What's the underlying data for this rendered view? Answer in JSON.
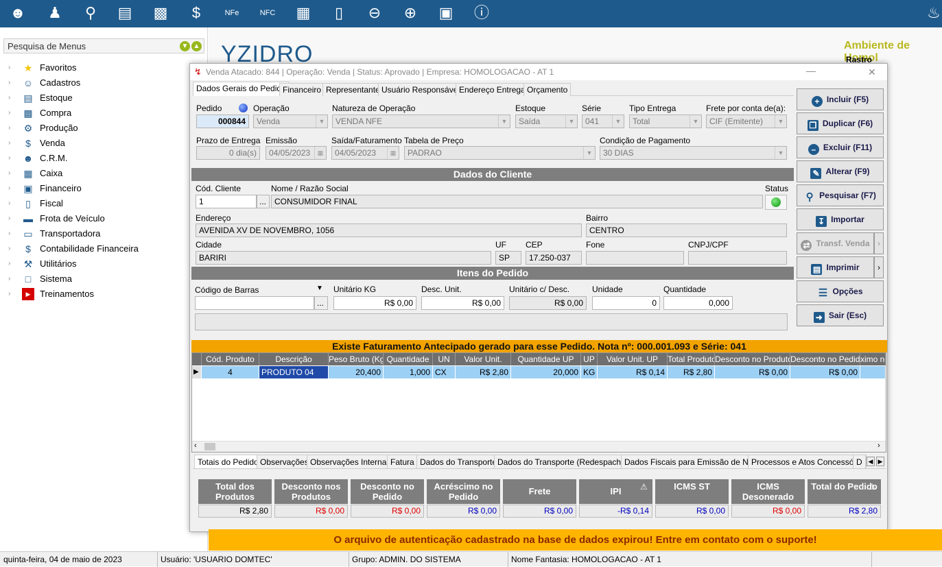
{
  "colors": {
    "topbar": "#1f5a8c",
    "banner": "#ffb400",
    "header": "#7e7e7e",
    "grid_selected": "#9dd0f5",
    "warning_bar": "#f2a300"
  },
  "topbar_icons": [
    "users-icon",
    "user-doc-icon",
    "search-doc-icon",
    "archive-icon",
    "basket-icon",
    "money-bag-icon",
    "nfe-icon",
    "nfce-icon",
    "cash-register-icon",
    "book-icon",
    "money-minus-icon",
    "money-plus-icon",
    "bill-icon",
    "info-icon",
    "bell-icon"
  ],
  "sidebar": {
    "search_placeholder": "Pesquisa de Menus",
    "items": [
      {
        "label": "Favoritos",
        "icon": "star-icon"
      },
      {
        "label": "Cadastros",
        "icon": "user-icon"
      },
      {
        "label": "Estoque",
        "icon": "box-icon"
      },
      {
        "label": "Compra",
        "icon": "basket-icon"
      },
      {
        "label": "Produção",
        "icon": "gear-icon"
      },
      {
        "label": "Venda",
        "icon": "money-bag-icon"
      },
      {
        "label": "C.R.M.",
        "icon": "people-icon"
      },
      {
        "label": "Caixa",
        "icon": "cash-register-icon"
      },
      {
        "label": "Financeiro",
        "icon": "money-icon"
      },
      {
        "label": "Fiscal",
        "icon": "document-icon"
      },
      {
        "label": "Frota de Veículo",
        "icon": "car-icon"
      },
      {
        "label": "Transportadora",
        "icon": "truck-icon"
      },
      {
        "label": "Contabilidade Financeira",
        "icon": "dollar-icon"
      },
      {
        "label": "Utilitários",
        "icon": "tools-icon"
      },
      {
        "label": "Sistema",
        "icon": "monitor-icon"
      },
      {
        "label": "Treinamentos",
        "icon": "youtube-icon"
      }
    ]
  },
  "background": {
    "logo": "YZIDRO",
    "ambiente": "Ambiente de Homol",
    "rastro": "Rastro"
  },
  "window": {
    "title": "Venda Atacado: 844 | Operação: Venda | Status: Aprovado | Empresa: HOMOLOGACAO - AT 1",
    "tabs": [
      "Dados Gerais do Pedido",
      "Financeiro",
      "Representante",
      "Usuário Responsável",
      "Endereço Entrega",
      "Orçamento"
    ],
    "labels": {
      "pedido": "Pedido",
      "operacao": "Operação",
      "natureza": "Natureza de Operação",
      "estoque": "Estoque",
      "serie": "Série",
      "tipo_entrega": "Tipo Entrega",
      "frete": "Frete por conta de(a):",
      "prazo": "Prazo de Entrega",
      "emissao": "Emissão",
      "saida": "Saída/Faturamento",
      "tabela": "Tabela de Preço",
      "condicao": "Condição de Pagamento",
      "cod_cliente": "Cód. Cliente",
      "nome": "Nome / Razão Social",
      "status": "Status",
      "endereco": "Endereço",
      "bairro": "Bairro",
      "cidade": "Cidade",
      "uf": "UF",
      "cep": "CEP",
      "fone": "Fone",
      "cnpj": "CNPJ/CPF",
      "codigo_barras": "Código de Barras",
      "unitario_kg": "Unitário KG",
      "desc_unit": "Desc. Unit.",
      "unitario_desc": "Unitário c/ Desc.",
      "unidade": "Unidade",
      "quantidade": "Quantidade"
    },
    "values": {
      "pedido": "000844",
      "operacao": "Venda",
      "natureza": "VENDA NFE",
      "estoque": "Saída",
      "serie": "041",
      "tipo_entrega": "Total",
      "frete": "CIF (Emitente)",
      "prazo": "0 dia(s)",
      "emissao": "04/05/2023",
      "saida": "04/05/2023",
      "tabela": "PADRAO",
      "condicao": "30 DIAS",
      "cod_cliente": "1",
      "nome": "CONSUMIDOR FINAL",
      "endereco": "AVENIDA XV DE NOVEMBRO, 1056",
      "bairro": "CENTRO",
      "cidade": "BARIRI",
      "uf": "SP",
      "cep": "17.250-037",
      "fone": "",
      "cnpj": "",
      "codigo_barras": "",
      "unitario_kg": "R$ 0,00",
      "desc_unit": "R$ 0,00",
      "unitario_desc": "R$ 0,00",
      "unidade": "0",
      "quantidade": "0,000"
    },
    "sections": {
      "cliente": "Dados do Cliente",
      "itens": "Itens do Pedido"
    },
    "ellipsis": "...",
    "buttons": [
      {
        "label": "Incluir (F5)",
        "icon": "plus-icon"
      },
      {
        "label": "Duplicar (F6)",
        "icon": "duplicate-icon"
      },
      {
        "label": "Excluir (F11)",
        "icon": "minus-icon"
      },
      {
        "label": "Alterar (F9)",
        "icon": "edit-icon"
      },
      {
        "label": "Pesquisar (F7)",
        "icon": "search-icon"
      },
      {
        "label": "Importar",
        "icon": "import-icon"
      },
      {
        "label": "Transf. Venda",
        "icon": "transfer-icon"
      },
      {
        "label": "Imprimir",
        "icon": "print-icon"
      },
      {
        "label": "Opções",
        "icon": "menu-icon"
      },
      {
        "label": "Sair (Esc)",
        "icon": "exit-icon"
      }
    ],
    "warning": "Existe Faturamento Antecipado gerado para esse Pedido. Nota nº: 000.001.093 e Série: 041",
    "grid": {
      "columns": [
        "Cód. Produto",
        "Descrição",
        "Peso Bruto (Kg)",
        "Quantidade",
        "UN",
        "Valor Unit.",
        "Quantidade UP",
        "UP",
        "Valor Unit. UP",
        "Total Produto",
        "Desconto no Produto",
        "Desconto no Pedido",
        "ximo no P"
      ],
      "row": [
        "4",
        "PRODUTO 04",
        "20,400",
        "1,000",
        "CX",
        "R$ 2,80",
        "20,000",
        "KG",
        "R$ 0,14",
        "R$ 2,80",
        "R$ 0,00",
        "R$ 0,00",
        ""
      ]
    },
    "bottom_tabs": [
      "Totais do Pedido",
      "Observações",
      "Observações Internas",
      "Fatura",
      "Dados do Transporte",
      "Dados do Transporte (Redespacho)",
      "Dados Fiscais para Emissão de NFe",
      "Processos e Atos Concessório",
      "D"
    ],
    "totals": [
      {
        "label": "Total dos Produtos",
        "value": "R$ 2,80",
        "color": "#000000"
      },
      {
        "label": "Desconto nos Produtos",
        "value": "R$ 0,00",
        "color": "#e00000"
      },
      {
        "label": "Desconto no Pedido",
        "value": "R$ 0,00",
        "color": "#e00000"
      },
      {
        "label": "Acréscimo no Pedido",
        "value": "R$ 0,00",
        "color": "#0000c0"
      },
      {
        "label": "Frete",
        "value": "R$ 0,00",
        "color": "#0000c0"
      },
      {
        "label": "IPI",
        "value": "-R$ 0,14",
        "color": "#0000c0"
      },
      {
        "label": "ICMS ST",
        "value": "R$ 0,00",
        "color": "#0000c0"
      },
      {
        "label": "ICMS Desonerado",
        "value": "R$ 0,00",
        "color": "#e00000"
      },
      {
        "label": "Total do Pedido",
        "value": "R$ 2,80",
        "color": "#0000c0"
      }
    ]
  },
  "banner": "O arquivo de autenticação cadastrado na base de dados expirou!  Entre em contato com o suporte!",
  "statusbar": {
    "date": "quinta-feira, 04 de maio de 2023",
    "user": "Usuário: 'USUARIO DOMTEC'",
    "group": "Grupo: ADMIN. DO SISTEMA",
    "company": "Nome Fantasia: HOMOLOGACAO - AT 1"
  }
}
